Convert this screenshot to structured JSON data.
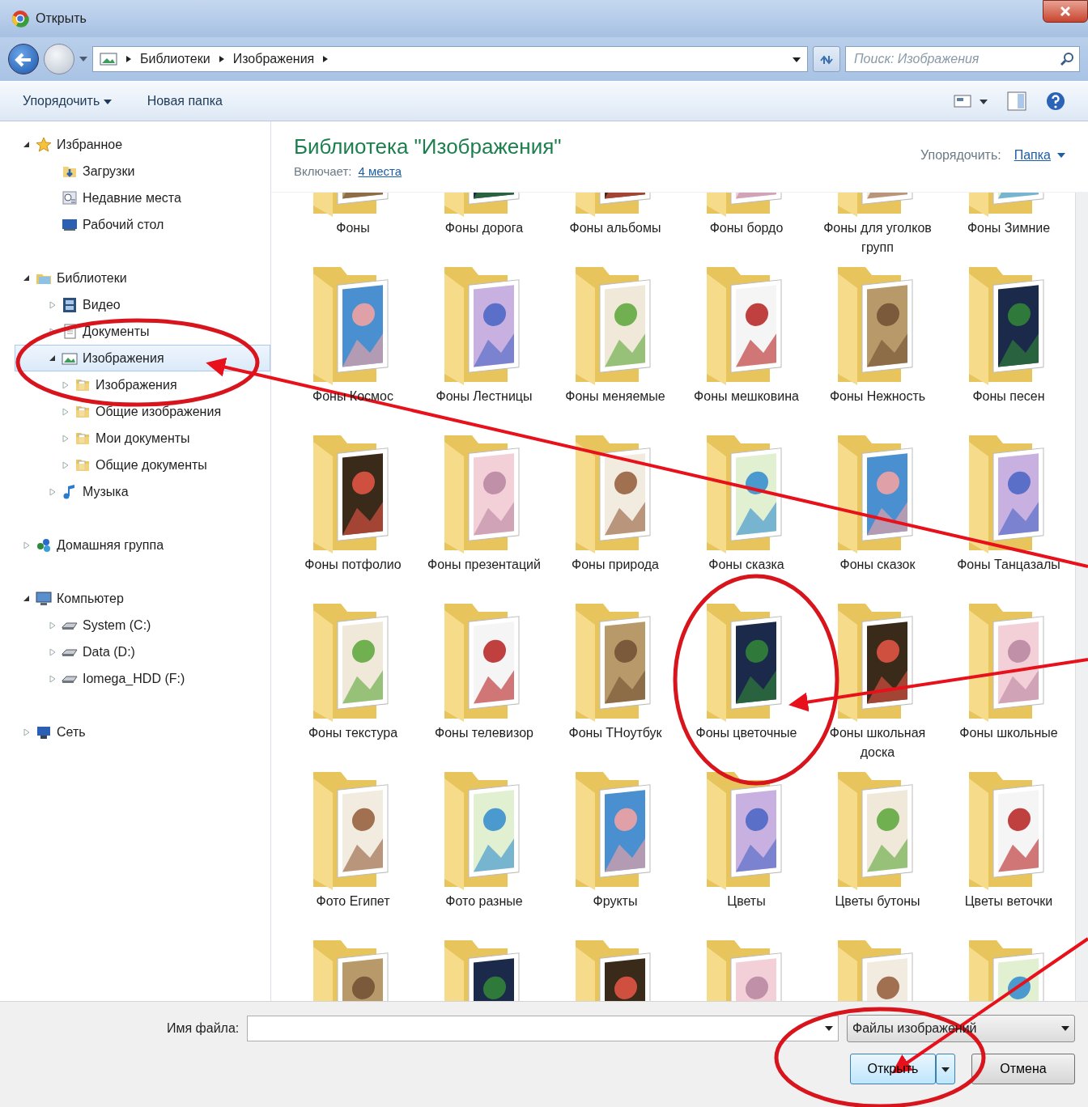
{
  "window": {
    "title": "Открыть"
  },
  "address": {
    "crumbs": [
      "Библиотеки",
      "Изображения"
    ],
    "search_placeholder": "Поиск: Изображения"
  },
  "toolbar": {
    "organize": "Упорядочить",
    "new_folder": "Новая папка"
  },
  "tree": [
    {
      "label": "Избранное",
      "kind": "star",
      "expanded": true,
      "selected": false,
      "children": [
        {
          "label": "Загрузки",
          "kind": "download",
          "selected": false
        },
        {
          "label": "Недавние места",
          "kind": "recent",
          "selected": false
        },
        {
          "label": "Рабочий стол",
          "kind": "desktop",
          "selected": false
        }
      ]
    },
    {
      "label": "Библиотеки",
      "kind": "library",
      "expanded": true,
      "selected": false,
      "children": [
        {
          "label": "Видео",
          "kind": "video",
          "expanded": false,
          "selected": false
        },
        {
          "label": "Документы",
          "kind": "docs",
          "expanded": false,
          "selected": false
        },
        {
          "label": "Изображения",
          "kind": "pictures",
          "expanded": true,
          "selected": true,
          "children": [
            {
              "label": "Изображения",
              "kind": "folder",
              "expanded": false,
              "selected": false
            },
            {
              "label": "Общие изображения",
              "kind": "folder",
              "expanded": false,
              "selected": false
            },
            {
              "label": "Мои документы",
              "kind": "folder",
              "expanded": false,
              "selected": false
            },
            {
              "label": "Общие документы",
              "kind": "folder",
              "expanded": false,
              "selected": false
            }
          ]
        },
        {
          "label": "Музыка",
          "kind": "music",
          "expanded": false,
          "selected": false
        }
      ]
    },
    {
      "label": "Домашняя группа",
      "kind": "homegroup",
      "expanded": false,
      "selected": false
    },
    {
      "label": "Компьютер",
      "kind": "computer",
      "expanded": true,
      "selected": false,
      "children": [
        {
          "label": "System (C:)",
          "kind": "drive",
          "expanded": false,
          "selected": false
        },
        {
          "label": "Data (D:)",
          "kind": "drive",
          "expanded": false,
          "selected": false
        },
        {
          "label": "Iomega_HDD (F:)",
          "kind": "drive",
          "expanded": false,
          "selected": false
        }
      ]
    },
    {
      "label": "Сеть",
      "kind": "network",
      "expanded": false,
      "selected": false
    }
  ],
  "library": {
    "title": "Библиотека \"Изображения\"",
    "includes_label": "Включает:",
    "includes_link": "4 места",
    "arrange_label": "Упорядочить:",
    "arrange_value": "Папка"
  },
  "folders": [
    {
      "kind": "folder",
      "label": "Фоны"
    },
    {
      "kind": "folder",
      "label": "Фоны  дорога"
    },
    {
      "kind": "folder",
      "label": "Фоны альбомы"
    },
    {
      "kind": "folder",
      "label": "Фоны бордо"
    },
    {
      "kind": "folder",
      "label": "Фоны для уголков групп"
    },
    {
      "kind": "folder",
      "label": "Фоны Зимние"
    },
    {
      "kind": "folder",
      "label": "Фоны Космос"
    },
    {
      "kind": "folder",
      "label": "Фоны Лестницы"
    },
    {
      "kind": "folder",
      "label": "Фоны меняемые"
    },
    {
      "kind": "folder",
      "label": "Фоны мешковина"
    },
    {
      "kind": "folder",
      "label": "Фоны Нежность"
    },
    {
      "kind": "folder",
      "label": "Фоны песен"
    },
    {
      "kind": "folder",
      "label": "Фоны потфолио"
    },
    {
      "kind": "folder",
      "label": "Фоны презентаций"
    },
    {
      "kind": "folder",
      "label": "Фоны природа"
    },
    {
      "kind": "folder",
      "label": "Фоны сказка"
    },
    {
      "kind": "folder",
      "label": "Фоны сказок"
    },
    {
      "kind": "folder",
      "label": "Фоны Танцазалы"
    },
    {
      "kind": "folder",
      "label": "Фоны текстура"
    },
    {
      "kind": "folder",
      "label": "Фоны телевизор"
    },
    {
      "kind": "folder",
      "label": "Фоны ТНоутбук"
    },
    {
      "kind": "folder",
      "label": "Фоны цветочные"
    },
    {
      "kind": "folder",
      "label": "Фоны школьная доска"
    },
    {
      "kind": "folder",
      "label": "Фоны школьные"
    },
    {
      "kind": "folder",
      "label": "Фото Египет"
    },
    {
      "kind": "folder",
      "label": "Фото разные"
    },
    {
      "kind": "folder",
      "label": "Фрукты"
    },
    {
      "kind": "folder",
      "label": "Цветы"
    },
    {
      "kind": "folder",
      "label": "Цветы бутоны"
    },
    {
      "kind": "folder",
      "label": "Цветы веточки"
    },
    {
      "kind": "folder"
    },
    {
      "kind": "folder"
    },
    {
      "kind": "folder"
    },
    {
      "kind": "folder"
    },
    {
      "kind": "folder"
    },
    {
      "kind": "folder"
    }
  ],
  "footer": {
    "filename_label": "Имя файла:",
    "filter": "Файлы изображений",
    "open": "Открыть",
    "cancel": "Отмена"
  },
  "annotations": [
    {
      "kind": "ellipse"
    },
    {
      "kind": "ellipse"
    },
    {
      "kind": "ellipse"
    },
    {
      "kind": "arrow"
    },
    {
      "kind": "arrow"
    },
    {
      "kind": "arrow"
    }
  ]
}
